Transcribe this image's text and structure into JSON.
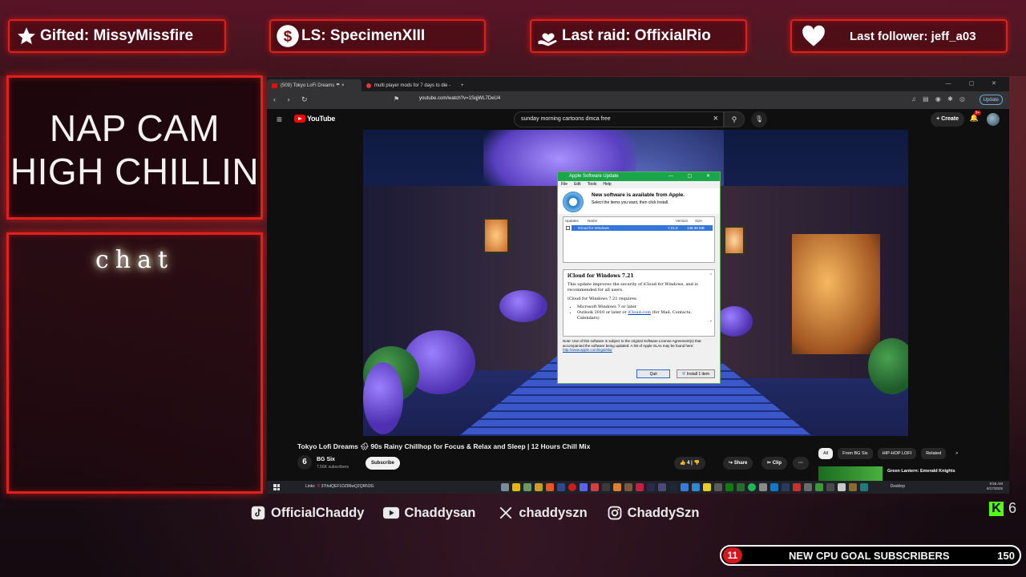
{
  "overlay": {
    "alerts": [
      {
        "label": "Gifted: MissyMissfire",
        "icon": "star-icon"
      },
      {
        "label": "LS: SpecimenXIII",
        "icon": "dollar-icon"
      },
      {
        "label": "Last raid: OffixialRio",
        "icon": "hand-heart-icon"
      },
      {
        "label": "Last follower: jeff_a03",
        "icon": "heart-icon"
      }
    ],
    "cam_title_line1": "NAP CAM",
    "cam_title_line2": "HIGH CHILLIN",
    "chat_label": "chat",
    "socials": [
      {
        "icon": "tiktok-icon",
        "handle": "OfficialChaddy"
      },
      {
        "icon": "youtube-icon",
        "handle": "Chaddysan"
      },
      {
        "icon": "x-icon",
        "handle": "chaddyszn"
      },
      {
        "icon": "instagram-icon",
        "handle": "ChaddySzn"
      }
    ],
    "kick": {
      "icon": "kick-icon",
      "count": "6"
    },
    "goal": {
      "current": "11",
      "label": "NEW CPU GOAL SUBSCRIBERS",
      "target": "150"
    }
  },
  "browser": {
    "tabs": [
      {
        "title": "(509) Tokyo LoFi Dreams ☂ ×",
        "active": true
      },
      {
        "title": "multi player mods for 7 days to die -",
        "active": false
      }
    ],
    "new_tab": "+",
    "url": "youtube.com/watch?v=1SqjWL7DeU4",
    "update_label": "Update"
  },
  "youtube": {
    "logo_text": "YouTube",
    "search_query": "sunday morning cartoons dmca free",
    "create_label": "+ Create",
    "notif_badge": "9+",
    "video_title": "Tokyo Lofi Dreams 🌧 90s Rainy Chillhop for Focus & Relax and Sleep | 12 Hours Chill Mix",
    "channel_avatar": "6",
    "channel_name": "BG Six",
    "channel_subs": "7.56K subscribers",
    "subscribe_label": "Subscribe",
    "like_count": "4",
    "share_label": "Share",
    "clip_label": "Clip",
    "more_label": "···",
    "chips": [
      "All",
      "From BG Six",
      "HIP-HOP LOFI",
      "Related",
      ">"
    ],
    "rec_title": "Green Lantern: Emerald Knights"
  },
  "dialog": {
    "title": "Apple Software Update",
    "menu": [
      "File",
      "Edit",
      "Tools",
      "Help"
    ],
    "heading": "New software is available from Apple.",
    "subheading": "Select the items you want, then click Install.",
    "columns": [
      "Updates",
      "Name",
      "Version",
      "Size"
    ],
    "row": {
      "name": "iCloud for Windows",
      "version": "7.21.0",
      "size": "138.36 MB"
    },
    "desc_title": "iCloud for Windows 7.21",
    "desc_p1": "This update improves the security of iCloud for Windows, and is recommended for all users.",
    "desc_p2": "iCloud for Windows 7.21 requires:",
    "desc_li1": "Microsoft Windows 7 or later",
    "desc_li2_a": "Outlook 2010 or later or ",
    "desc_li2_link": "iCloud.com",
    "desc_li2_b": " (for Mail, Contacts, Calendars)",
    "note": "Note: Use of this software is subject to the original Software License Agreement(s) that accompanied the software being updated. A list of Apple SLAs may be found here:",
    "note_link": "http://www.apple.com/legal/sla/",
    "quit_label": "Quit",
    "install_label": "Install 1 item"
  },
  "taskbar": {
    "links_label": "Links",
    "links_text": "37thdQEF1DZ86wQ2QRN3G",
    "desktop_label": "Desktop",
    "time": "9:56 AM",
    "date": "8/17/2025"
  }
}
